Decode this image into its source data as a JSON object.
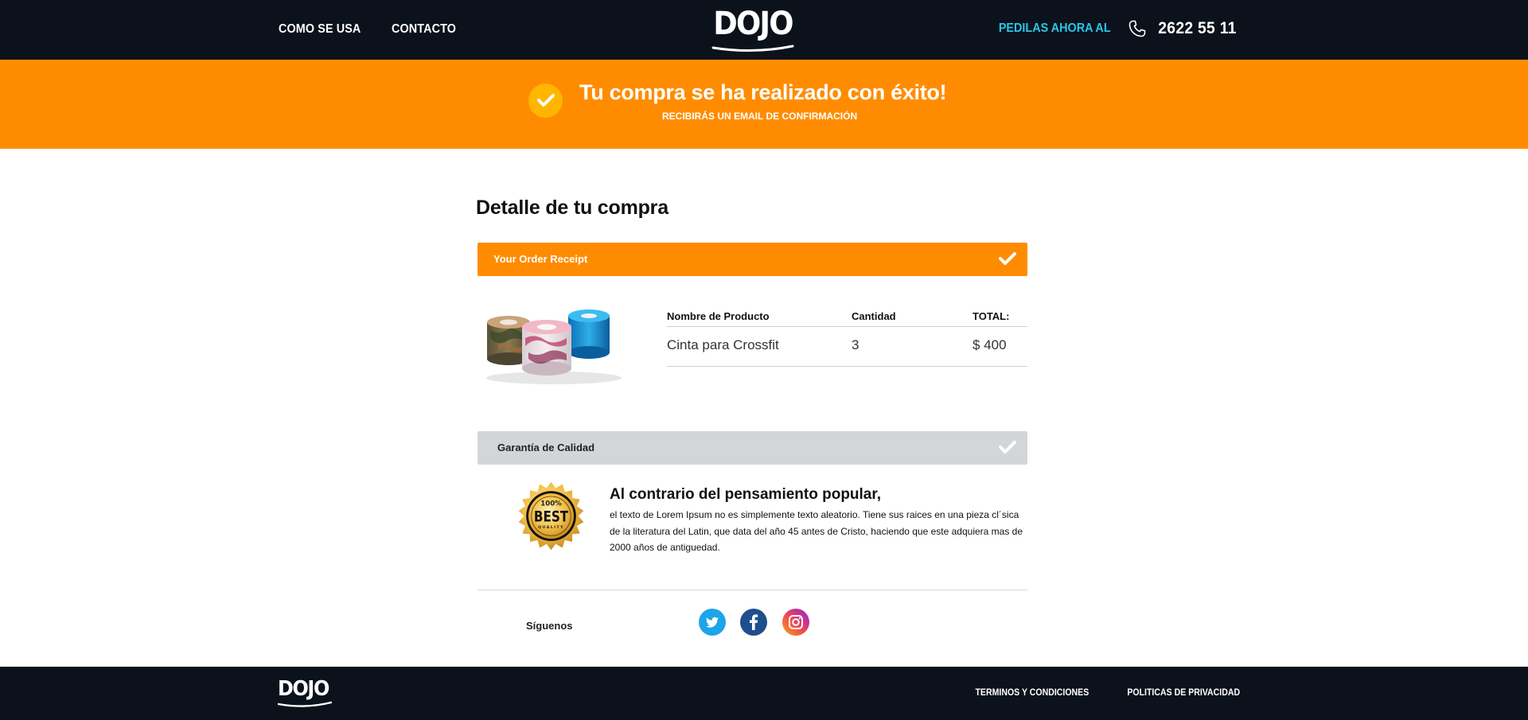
{
  "header": {
    "nav": [
      {
        "label": "COMO SE USA"
      },
      {
        "label": "CONTACTO"
      }
    ],
    "logo_text": "DOJO",
    "phone_cta": "PEDILAS AHORA AL",
    "phone_number": "2622 55 11",
    "phone_icon": "phone-icon"
  },
  "banner": {
    "title": "Tu compra se ha realizado con éxito!",
    "subtitle": "RECIBIRÁS UN EMAIL DE CONFIRMACIÓN",
    "icon": "check-circle-icon"
  },
  "main": {
    "title": "Detalle de tu compra",
    "receipt_bar": {
      "label": "Your Order Receipt"
    },
    "table": {
      "headers": [
        "Nombre de Producto",
        "Cantidad",
        "TOTAL:"
      ],
      "rows": [
        {
          "product": "Cinta para Crossfit",
          "quantity": "3",
          "total": "$ 400"
        }
      ]
    },
    "quality_bar": {
      "label": "Garantía de Calidad"
    },
    "quality": {
      "title": "Al contrario del pensamiento popular,",
      "body": "el texto de Lorem Ipsum no es simplemente texto aleatorio. Tiene sus raices en una pieza cl´sica de la literatura del Latin, que data del año 45 antes de Cristo, haciendo que este adquiera mas de 2000 años de antiguedad.",
      "seal_text_top": "100%",
      "seal_text_main": "BEST",
      "seal_text_bottom": "QUALITY"
    },
    "follow_label": "Síguenos",
    "social": [
      "twitter-icon",
      "facebook-icon",
      "instagram-icon"
    ]
  },
  "footer": {
    "logo_text": "DOJO",
    "links": [
      "TERMINOS Y CONDICIONES",
      "POLITICAS DE PRIVACIDAD"
    ]
  },
  "colors": {
    "dark": "#0b121b",
    "orange": "#ff8c00",
    "accent_cyan": "#29c6e8",
    "gray_bar": "#d4d5d7"
  }
}
